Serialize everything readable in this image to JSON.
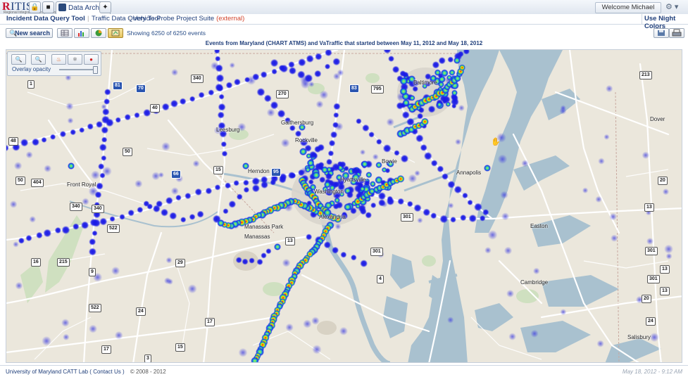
{
  "app": {
    "logo_text": "RITIS",
    "logo_subtitle": "Regional Integrated Transportation Information System",
    "active_tab": "Data Archive",
    "welcome": "Welcome Michael Pack!"
  },
  "nav": {
    "incident_tool": "Incident Data Query Tool",
    "traffic_tool": "Traffic Data Query Tool",
    "vpp_tool": "Vehicle Probe Project Suite",
    "external_tag": "(external)",
    "night_colors": "Use Night Colors"
  },
  "toolbar": {
    "new_search": "New search",
    "showing": "Showing 6250 of 6250 events",
    "view_buttons": [
      "table-view",
      "bar-chart-view",
      "pie-chart-view",
      "map-view"
    ],
    "active_view": "map-view"
  },
  "query_title": "Events from Maryland (CHART ATMS) and VaTraffic that started between May 11, 2012 and May 18, 2012",
  "overlay": {
    "opacity_label": "Overlay opacity",
    "opacity_value": 0.95,
    "buttons": [
      "zoom-in",
      "zoom-out",
      "fire-heatmap",
      "clusters",
      "dot-colors"
    ]
  },
  "map": {
    "places": [
      "Baltimore",
      "Gaithersburg",
      "Rockville",
      "Leesburg",
      "Herndon",
      "Bowie",
      "Annapolis",
      "Washington",
      "Hyattsville",
      "Alexandria",
      "Manassas Park",
      "Manassas",
      "Front Royal",
      "Dover",
      "Easton",
      "Cambridge",
      "Salisbury"
    ],
    "shields": [
      "340",
      "81",
      "70",
      "270",
      "795",
      "83",
      "40",
      "50",
      "15",
      "95",
      "66",
      "340",
      "522",
      "301",
      "213",
      "13",
      "404",
      "50",
      "16",
      "9",
      "215",
      "522",
      "29",
      "24",
      "17",
      "15",
      "3",
      "301",
      "4",
      "13",
      "301",
      "301",
      "48",
      "340",
      "24",
      "17",
      "13",
      "13",
      "20",
      "20",
      "301",
      "1"
    ],
    "colors": {
      "water": "#a9c1cf",
      "land": "#ebe7dc",
      "road": "#ffffff",
      "hot": "#ff2a00",
      "cool": "#1717e0"
    }
  },
  "footer": {
    "org": "University of Maryland CATT Lab",
    "contact": "Contact Us",
    "copyright": "© 2008 - 2012",
    "timestamp": "May 18, 2012 - 9:12 AM"
  }
}
